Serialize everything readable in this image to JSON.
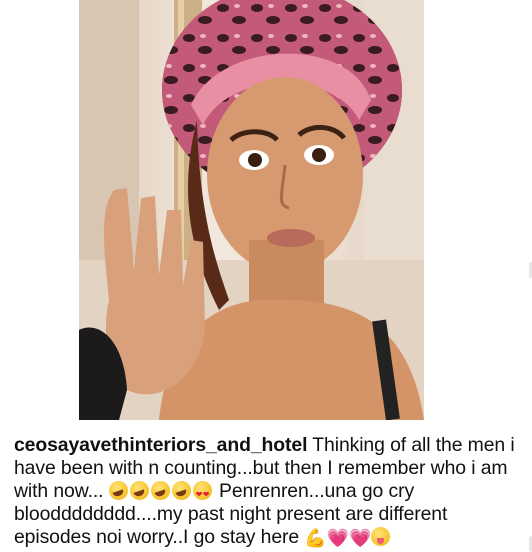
{
  "post": {
    "username": "ceosayavethinteriors_and_hotel",
    "caption_part1": " Thinking of all the men i have been with n counting...but then I remember who i am with now...",
    "caption_part2": " Penrenren...una go cry bloodddddddd....my past night present are different episodes noi worry..I go stay here ",
    "emoji_after_part1": [
      "rolling-on-floor-laughing",
      "rolling-on-floor-laughing",
      "rolling-on-floor-laughing",
      "rolling-on-floor-laughing",
      "smiling-face-with-heart-eyes"
    ],
    "emoji_after_part2": [
      "flexed-biceps",
      "growing-heart",
      "growing-heart",
      "winking-face-with-tongue"
    ]
  },
  "photo": {
    "subject": "woman-in-leopard-bonnet-holding-up-four-fingers",
    "colors": {
      "bonnet": "#c45a7a",
      "headband": "#e98fa3",
      "skin": "#d7996f",
      "background": "#efe3d7"
    }
  }
}
